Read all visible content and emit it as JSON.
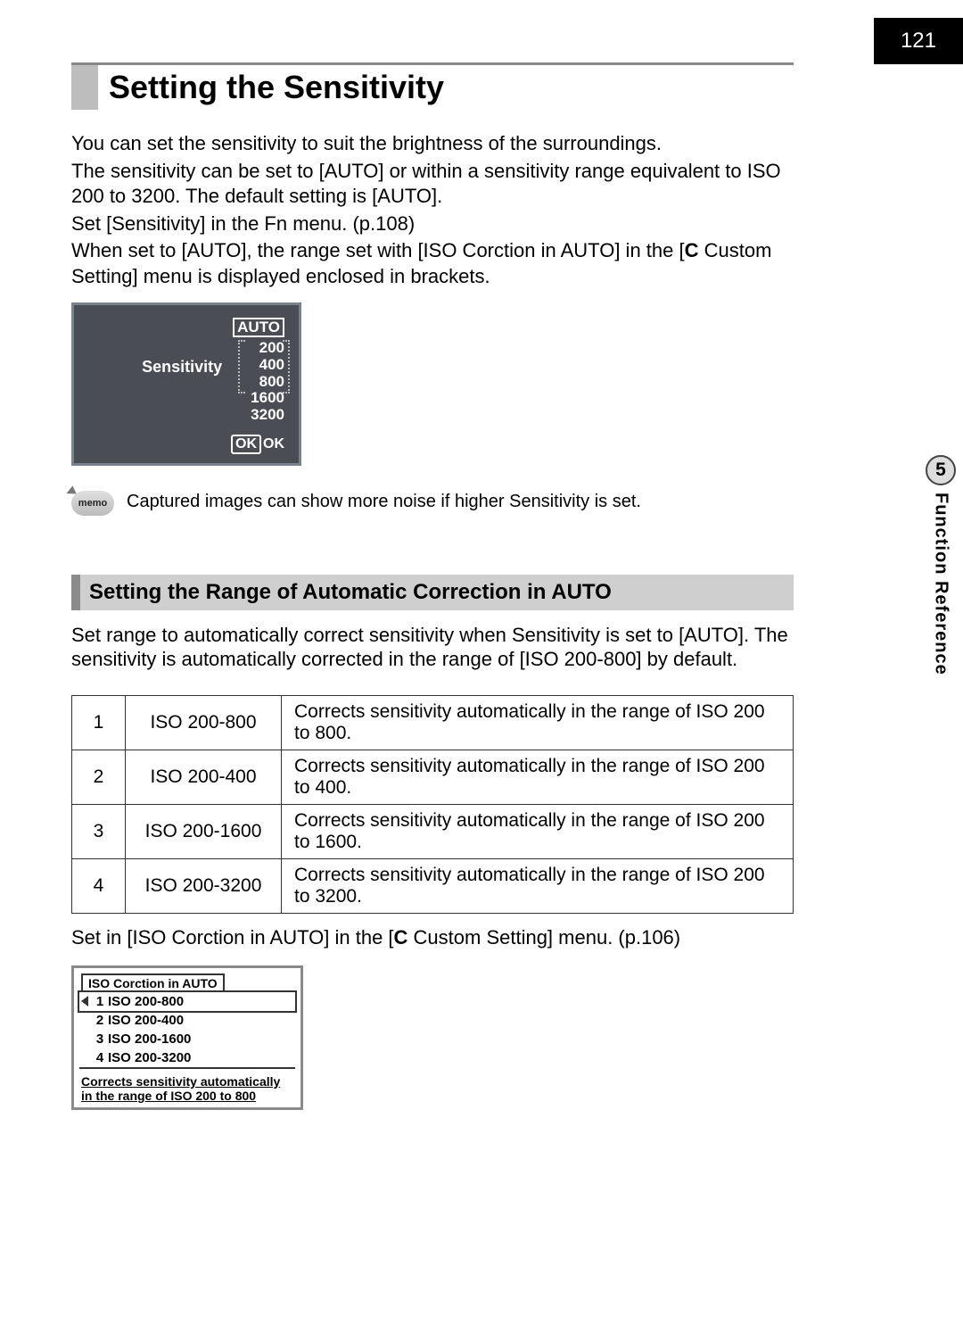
{
  "page_number": "121",
  "side": {
    "number": "5",
    "label": "Function Reference"
  },
  "title": "Setting the Sensitivity",
  "intro": {
    "l1": "You can set the sensitivity to suit the brightness of the surroundings.",
    "l2": "The sensitivity can be set to [AUTO] or within a sensitivity range equivalent to ISO 200 to 3200. The default setting is [AUTO].",
    "l3": "Set [Sensitivity] in the Fn menu. (p.108)",
    "l4a": "When set to [AUTO], the range set with [ISO Corction in AUTO] in the [",
    "l4b": "C",
    "l4c": " Custom Setting] menu is displayed enclosed in brackets."
  },
  "lcd": {
    "label": "Sensitivity",
    "auto": "AUTO",
    "v1": "200",
    "v2": "400",
    "v3": "800",
    "v4": "1600",
    "v5": "3200",
    "ok": "OK"
  },
  "memo": {
    "badge": "memo",
    "text": "Captured images can show more noise if higher Sensitivity is set."
  },
  "sub_heading": "Setting the Range of Automatic Correction in AUTO",
  "sub_para": "Set range to automatically correct sensitivity when Sensitivity is set to [AUTO]. The sensitivity is automatically corrected in the range of [ISO 200-800] by default.",
  "table": [
    {
      "n": "1",
      "range": "ISO 200-800",
      "desc": "Corrects sensitivity automatically in the range of ISO 200 to 800."
    },
    {
      "n": "2",
      "range": "ISO 200-400",
      "desc": "Corrects sensitivity automatically in the range of ISO 200 to 400."
    },
    {
      "n": "3",
      "range": "ISO 200-1600",
      "desc": "Corrects sensitivity automatically in the range of ISO 200 to 1600."
    },
    {
      "n": "4",
      "range": "ISO 200-3200",
      "desc": "Corrects sensitivity automatically in the range of ISO 200 to 3200."
    }
  ],
  "foota": "Set in [ISO Corction in AUTO] in the [",
  "footb": "C",
  "footc": " Custom Setting] menu. (p.106)",
  "menu": {
    "tab": "ISO Corction in AUTO",
    "items": [
      {
        "n": "1",
        "label": "ISO 200-800"
      },
      {
        "n": "2",
        "label": "ISO 200-400"
      },
      {
        "n": "3",
        "label": "ISO 200-1600"
      },
      {
        "n": "4",
        "label": "ISO 200-3200"
      }
    ],
    "desc": "Corrects sensitivity automatically in the range of ISO 200 to 800"
  }
}
